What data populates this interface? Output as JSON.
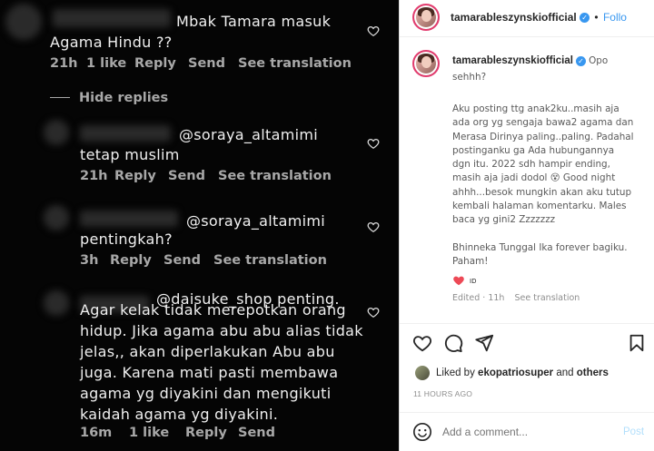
{
  "comments_panel": {
    "comment1": {
      "text_line1": "Mbak Tamara masuk",
      "text_line2": "Agama Hindu ??",
      "time": "21h",
      "likes": "1 like",
      "reply": "Reply",
      "send": "Send",
      "see_translation": "See translation"
    },
    "hide_replies": "Hide replies",
    "reply1": {
      "mention": "@soraya_altamimi",
      "text": "tetap muslim",
      "time": "21h",
      "reply": "Reply",
      "send": "Send",
      "see_translation": "See translation"
    },
    "reply2": {
      "mention": "@soraya_altamimi",
      "text": "pentingkah?",
      "time": "3h",
      "reply": "Reply",
      "send": "Send",
      "see_translation": "See translation"
    },
    "reply3": {
      "line1": "@daisuke_shop penting.",
      "line2": "Agar kelak tidak merepotkan orang",
      "line3": "hidup. Jika agama abu abu alias tidak",
      "line4": "jelas,, akan diperlakukan Abu abu",
      "line5": "juga. Karena mati pasti membawa",
      "line6": "agama yg diyakini dan mengikuti",
      "line7": "kaidah agama yg diyakini.",
      "time": "16m",
      "likes": "1 like",
      "reply": "Reply",
      "send": "Send"
    }
  },
  "post_panel": {
    "header": {
      "username": "tamarableszynskiofficial",
      "separator": "•",
      "follow": "Follo"
    },
    "caption": {
      "username": "tamarableszynskiofficial",
      "lead": "Opo",
      "lead2": "sehhh?",
      "body": "Aku posting ttg anak2ku..masih aja\nada org yg sengaja bawa2 agama dan\nMerasa Dirinya paling..paling. Padahal\npostinganku ga Ada hubungannya\ndgn itu. 2022 sdh hampir ending,\nmasih aja jadi dodol 😵 Good night\nahhh...besok mungkin akan aku tutup\nkembali halaman komentarku. Males\nbaca yg gini2 Zzzzzzz\n\nBhinneka Tunggal Ika forever bagiku.\nPaham!",
      "flag": "ID",
      "edited": "Edited · 11h",
      "see_translation": "See translation"
    },
    "likes": {
      "prefix": "Liked by",
      "user": "ekopatriosuper",
      "middle": "and",
      "others": "others"
    },
    "timestamp": "11 HOURS AGO",
    "comment_box": {
      "placeholder": "Add a comment...",
      "post": "Post"
    },
    "colors": {
      "accent": "#3897f0",
      "heart": "#ed4956",
      "dark_bg": "#050505"
    }
  }
}
